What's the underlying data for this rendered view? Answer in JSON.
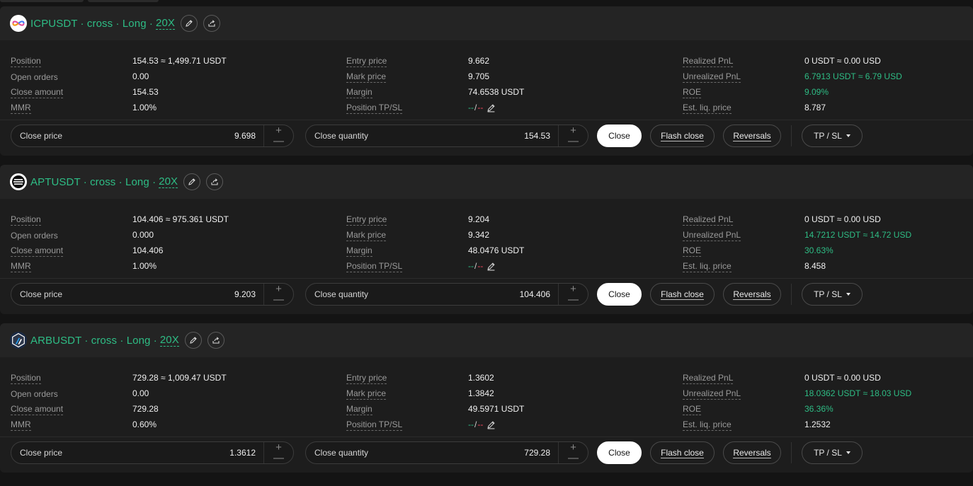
{
  "labels": {
    "position": "Position",
    "open_orders": "Open orders",
    "close_amount": "Close amount",
    "mmr": "MMR",
    "entry_price": "Entry price",
    "mark_price": "Mark price",
    "margin": "Margin",
    "position_tpsl": "Position TP/SL",
    "realized_pnl": "Realized PnL",
    "unrealized_pnl": "Unrealized PnL",
    "roe": "ROE",
    "est_liq_price": "Est. liq. price",
    "close_price": "Close price",
    "close_quantity": "Close quantity",
    "close": "Close",
    "flash_close": "Flash close",
    "reversals": "Reversals",
    "tpsl_button": "TP / SL",
    "plus": "+",
    "minus": "—",
    "tp_placeholder": "--",
    "sl_placeholder": "--",
    "tpsl_separator": "/"
  },
  "colors": {
    "accent_green": "#2ebd85",
    "accent_red": "#f6465d",
    "background": "#141414",
    "card": "#1d1d1d",
    "card_header": "#242424"
  },
  "positions": [
    {
      "symbol": "ICPUSDT · cross · Long ·",
      "leverage": "20X",
      "icon": "icp-coin-icon",
      "position": "154.53 ≈ 1,499.71 USDT",
      "open_orders": "0.00",
      "close_amount": "154.53",
      "mmr": "1.00%",
      "entry_price": "9.662",
      "mark_price": "9.705",
      "margin": "74.6538 USDT",
      "realized_pnl": "0 USDT ≈ 0.00 USD",
      "unrealized_pnl": "6.7913 USDT ≈ 6.79 USD",
      "roe": "9.09%",
      "est_liq_price": "8.787",
      "close_price": "9.698",
      "close_quantity": "154.53"
    },
    {
      "symbol": "APTUSDT · cross · Long ·",
      "leverage": "20X",
      "icon": "apt-coin-icon",
      "position": "104.406 ≈ 975.361 USDT",
      "open_orders": "0.000",
      "close_amount": "104.406",
      "mmr": "1.00%",
      "entry_price": "9.204",
      "mark_price": "9.342",
      "margin": "48.0476 USDT",
      "realized_pnl": "0 USDT ≈ 0.00 USD",
      "unrealized_pnl": "14.7212 USDT ≈ 14.72 USD",
      "roe": "30.63%",
      "est_liq_price": "8.458",
      "close_price": "9.203",
      "close_quantity": "104.406"
    },
    {
      "symbol": "ARBUSDT · cross · Long ·",
      "leverage": "20X",
      "icon": "arb-coin-icon",
      "position": "729.28 ≈ 1,009.47 USDT",
      "open_orders": "0.00",
      "close_amount": "729.28",
      "mmr": "0.60%",
      "entry_price": "1.3602",
      "mark_price": "1.3842",
      "margin": "49.5971 USDT",
      "realized_pnl": "0 USDT ≈ 0.00 USD",
      "unrealized_pnl": "18.0362 USDT ≈ 18.03 USD",
      "roe": "36.36%",
      "est_liq_price": "1.2532",
      "close_price": "1.3612",
      "close_quantity": "729.28"
    }
  ]
}
